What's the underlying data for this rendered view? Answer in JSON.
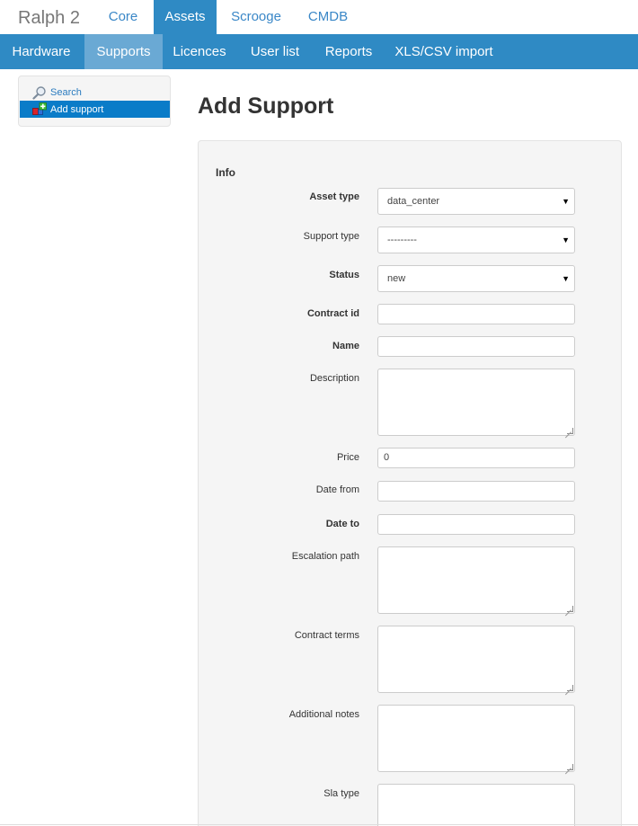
{
  "brand": "Ralph 2",
  "top_tabs": [
    {
      "label": "Core"
    },
    {
      "label": "Assets"
    },
    {
      "label": "Scrooge"
    },
    {
      "label": "CMDB"
    }
  ],
  "sub_tabs": [
    {
      "label": "Hardware"
    },
    {
      "label": "Supports"
    },
    {
      "label": "Licences"
    },
    {
      "label": "User list"
    },
    {
      "label": "Reports"
    },
    {
      "label": "XLS/CSV import"
    }
  ],
  "sidebar": {
    "search": {
      "label": "Search",
      "icon": "magnifier-icon"
    },
    "add_support": {
      "label": "Add support",
      "icon": "add-blocks-icon"
    }
  },
  "page_title": "Add Support",
  "form": {
    "legend": "Info",
    "asset_type": {
      "label": "Asset type",
      "value": "data_center"
    },
    "support_type": {
      "label": "Support type",
      "value": "---------"
    },
    "status": {
      "label": "Status",
      "value": "new"
    },
    "contract_id": {
      "label": "Contract id",
      "value": ""
    },
    "name": {
      "label": "Name",
      "value": ""
    },
    "description": {
      "label": "Description",
      "value": ""
    },
    "price": {
      "label": "Price",
      "value": "0"
    },
    "date_from": {
      "label": "Date from",
      "value": ""
    },
    "date_to": {
      "label": "Date to",
      "value": ""
    },
    "escalation_path": {
      "label": "Escalation path",
      "value": ""
    },
    "contract_terms": {
      "label": "Contract terms",
      "value": ""
    },
    "additional_notes": {
      "label": "Additional notes",
      "value": ""
    },
    "sla_type": {
      "label": "Sla type",
      "value": ""
    }
  },
  "colors": {
    "nav_blue": "#2f8ac4",
    "sub_active": "#6aa9d4",
    "sidebar_active": "#0a7cc8",
    "link": "#3a87c7"
  }
}
